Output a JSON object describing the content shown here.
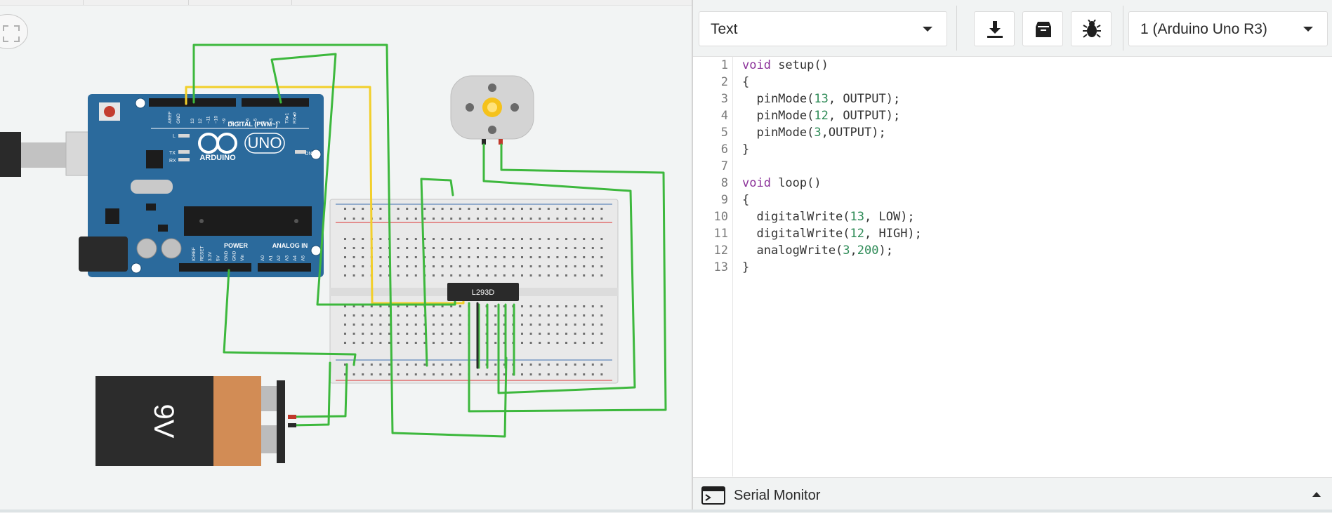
{
  "toolbar": {
    "mode_label": "Text",
    "device_label": "1 (Arduino Uno R3)",
    "icons": [
      "download-icon",
      "library-icon",
      "debug-bug-icon",
      "chevron-down-icon"
    ]
  },
  "code": {
    "lines": [
      {
        "n": "1",
        "tokens": [
          [
            "kw",
            "void"
          ],
          [
            "t",
            " setup()"
          ]
        ]
      },
      {
        "n": "2",
        "tokens": [
          [
            "t",
            "{"
          ]
        ]
      },
      {
        "n": "3",
        "tokens": [
          [
            "t",
            "  pinMode("
          ],
          [
            "num",
            "13"
          ],
          [
            "t",
            ", OUTPUT);"
          ]
        ]
      },
      {
        "n": "4",
        "tokens": [
          [
            "t",
            "  pinMode("
          ],
          [
            "num",
            "12"
          ],
          [
            "t",
            ", OUTPUT);"
          ]
        ]
      },
      {
        "n": "5",
        "tokens": [
          [
            "t",
            "  pinMode("
          ],
          [
            "num",
            "3"
          ],
          [
            "t",
            ",OUTPUT);"
          ]
        ]
      },
      {
        "n": "6",
        "tokens": [
          [
            "t",
            "}"
          ]
        ]
      },
      {
        "n": "7",
        "tokens": []
      },
      {
        "n": "8",
        "tokens": [
          [
            "kw",
            "void"
          ],
          [
            "t",
            " loop()"
          ]
        ]
      },
      {
        "n": "9",
        "tokens": [
          [
            "t",
            "{"
          ]
        ]
      },
      {
        "n": "10",
        "tokens": [
          [
            "t",
            "  digitalWrite("
          ],
          [
            "num",
            "13"
          ],
          [
            "t",
            ", LOW);"
          ]
        ]
      },
      {
        "n": "11",
        "tokens": [
          [
            "t",
            "  digitalWrite("
          ],
          [
            "num",
            "12"
          ],
          [
            "t",
            ", HIGH);"
          ]
        ]
      },
      {
        "n": "12",
        "tokens": [
          [
            "t",
            "  analogWrite("
          ],
          [
            "num",
            "3"
          ],
          [
            "t",
            ","
          ],
          [
            "num",
            "200"
          ],
          [
            "t",
            ");"
          ]
        ]
      },
      {
        "n": "13",
        "tokens": [
          [
            "t",
            "}"
          ]
        ]
      }
    ]
  },
  "serial": {
    "label": "Serial Monitor"
  },
  "circuit": {
    "arduino": {
      "brand": "ARDUINO",
      "model": "UNO",
      "digital_label": "DIGITAL (PWM~)",
      "power_label": "POWER",
      "analog_label": "ANALOG IN",
      "on_label": "ON",
      "l_label": "L",
      "tx_label": "TX",
      "rx_label": "RX",
      "aref_label": "AREF",
      "gnd_label": "GND",
      "digital_pins": [
        "13",
        "12",
        "~11",
        "~10",
        "~9",
        "8",
        "7",
        "~6",
        "~5",
        "4",
        "~3",
        "2",
        "TX▸1",
        "RX◂0"
      ],
      "power_pins": [
        "IOREF",
        "RESET",
        "3.3V",
        "5V",
        "GND",
        "GND",
        "Vin"
      ],
      "analog_pins": [
        "A0",
        "A1",
        "A2",
        "A3",
        "A4",
        "A5"
      ]
    },
    "ic_label": "L293D",
    "battery_label": "9V",
    "colors": {
      "wire_green": "#3db83d",
      "wire_yellow": "#f2cf2a",
      "arduino_blue": "#2b6a9c",
      "battery_orange": "#d28c55",
      "battery_black": "#2c2c2c"
    }
  }
}
